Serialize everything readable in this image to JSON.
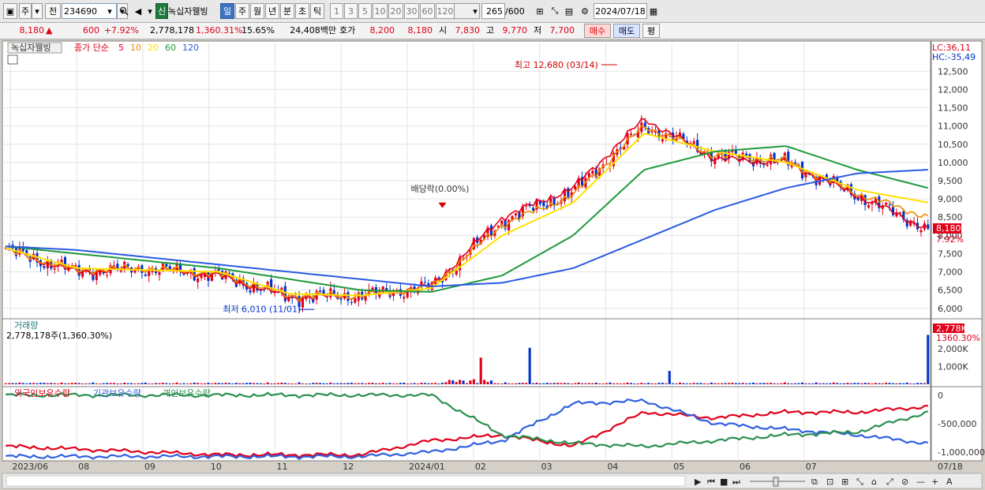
{
  "toolbar": {
    "type_label": "주",
    "prev_label": "전",
    "code": "234690",
    "badge": "신",
    "name": "녹십자웰빙",
    "periods": [
      "일",
      "주",
      "월",
      "년",
      "분",
      "초",
      "틱"
    ],
    "active_period": "일",
    "ticks": [
      "1",
      "3",
      "5",
      "10",
      "20",
      "30",
      "60",
      "120"
    ],
    "count": "265",
    "count_max": "/600",
    "date": "2024/07/18"
  },
  "info": {
    "price": "8,180",
    "change": "600",
    "change_pct": "+7.92%",
    "volume": "2,778,178",
    "volume_ratio": "1,360.31%",
    "turnover": "15.65%",
    "amount": "24,408백만",
    "ask_label": "호가",
    "ask": "8,200",
    "bid": "8,180",
    "open_label": "시",
    "open": "7,830",
    "high_label": "고",
    "high": "9,770",
    "low_label": "저",
    "low": "7,700",
    "buy_label": "매수",
    "sell_label": "매도",
    "eval_label": "평"
  },
  "price_panel": {
    "name_tag": "녹십자웰빙",
    "ma_label": "종가 단순",
    "ma_periods": [
      "5",
      "10",
      "20",
      "60",
      "120"
    ],
    "lc": "LC:36,11",
    "hc": "HC:-35,49",
    "max_note": "최고 12,680 (03/14)",
    "min_note": "최저 6,010 (11/01)",
    "dividend_note": "배당락(0.00%)",
    "current_tag": "8,180",
    "current_pct": "7.92%",
    "y_labels": [
      "12,500",
      "12,000",
      "11,500",
      "11,000",
      "10,500",
      "10,000",
      "9,500",
      "9,000",
      "8,500",
      "8,000",
      "7,500",
      "7,000",
      "6,500",
      "6,000"
    ]
  },
  "volume_panel": {
    "title": "거래량",
    "value": "2,778,178주(1,360.30%)",
    "tag": "2,778K",
    "tag_pct": "1360.30%",
    "y_labels": [
      "2,000K",
      "1,000K"
    ]
  },
  "holdings_panel": {
    "foreign": "외국인보유수량",
    "institution": "기관보유수량",
    "individual": "개인보유수량",
    "y_labels": [
      "0",
      "-500,000",
      "-1,000,000"
    ]
  },
  "x_labels": [
    "2023/06",
    "08",
    "09",
    "10",
    "11",
    "12",
    "2024/01",
    "02",
    "03",
    "04",
    "05",
    "06",
    "07"
  ],
  "x_right_label": "07/18",
  "colors": {
    "up": "#e0001a",
    "down": "#0033cc",
    "ma5": "#e0001a",
    "ma10": "#f08c00",
    "ma20": "#ffe000",
    "ma60": "#1f9a3c",
    "ma120": "#2a5be0",
    "foreign": "#e0001a",
    "institution": "#3060e0",
    "individual": "#2a9050"
  },
  "chart_data": {
    "type": "line",
    "price_range": [
      5800,
      12680
    ],
    "monthly_close": [
      {
        "x": "2023/06",
        "y": 7600
      },
      {
        "x": "2023/07",
        "y": 7000
      },
      {
        "x": "2023/08",
        "y": 7100
      },
      {
        "x": "2023/09",
        "y": 6900
      },
      {
        "x": "2023/10",
        "y": 6300
      },
      {
        "x": "2023/11",
        "y": 6350
      },
      {
        "x": "2023/12",
        "y": 6600
      },
      {
        "x": "2024/01",
        "y": 8400
      },
      {
        "x": "2024/02",
        "y": 9200
      },
      {
        "x": "2024/03",
        "y": 11000
      },
      {
        "x": "2024/04",
        "y": 10200
      },
      {
        "x": "2024/05",
        "y": 10000
      },
      {
        "x": "2024/06",
        "y": 9100
      },
      {
        "x": "2024/07",
        "y": 8180
      }
    ],
    "series": [
      {
        "name": "5",
        "values": [
          7600,
          7000,
          7100,
          6900,
          6300,
          6350,
          6600,
          8500,
          9300,
          11200,
          10100,
          10000,
          9100,
          8180
        ]
      },
      {
        "name": "10",
        "values": [
          7600,
          7050,
          7100,
          6950,
          6350,
          6350,
          6580,
          8300,
          9100,
          11000,
          10200,
          10050,
          9150,
          8500
        ]
      },
      {
        "name": "20",
        "values": [
          7650,
          7100,
          7050,
          7000,
          6400,
          6350,
          6550,
          8000,
          8900,
          10800,
          10300,
          10000,
          9250,
          8900
        ]
      },
      {
        "name": "60",
        "values": [
          7700,
          7500,
          7300,
          7100,
          6800,
          6500,
          6450,
          6900,
          8000,
          9800,
          10300,
          10450,
          9800,
          9300
        ]
      },
      {
        "name": "120",
        "values": [
          7700,
          7600,
          7400,
          7200,
          7000,
          6800,
          6600,
          6700,
          7100,
          7900,
          8700,
          9300,
          9700,
          9800
        ]
      }
    ],
    "volume_peak": 2778178
  }
}
